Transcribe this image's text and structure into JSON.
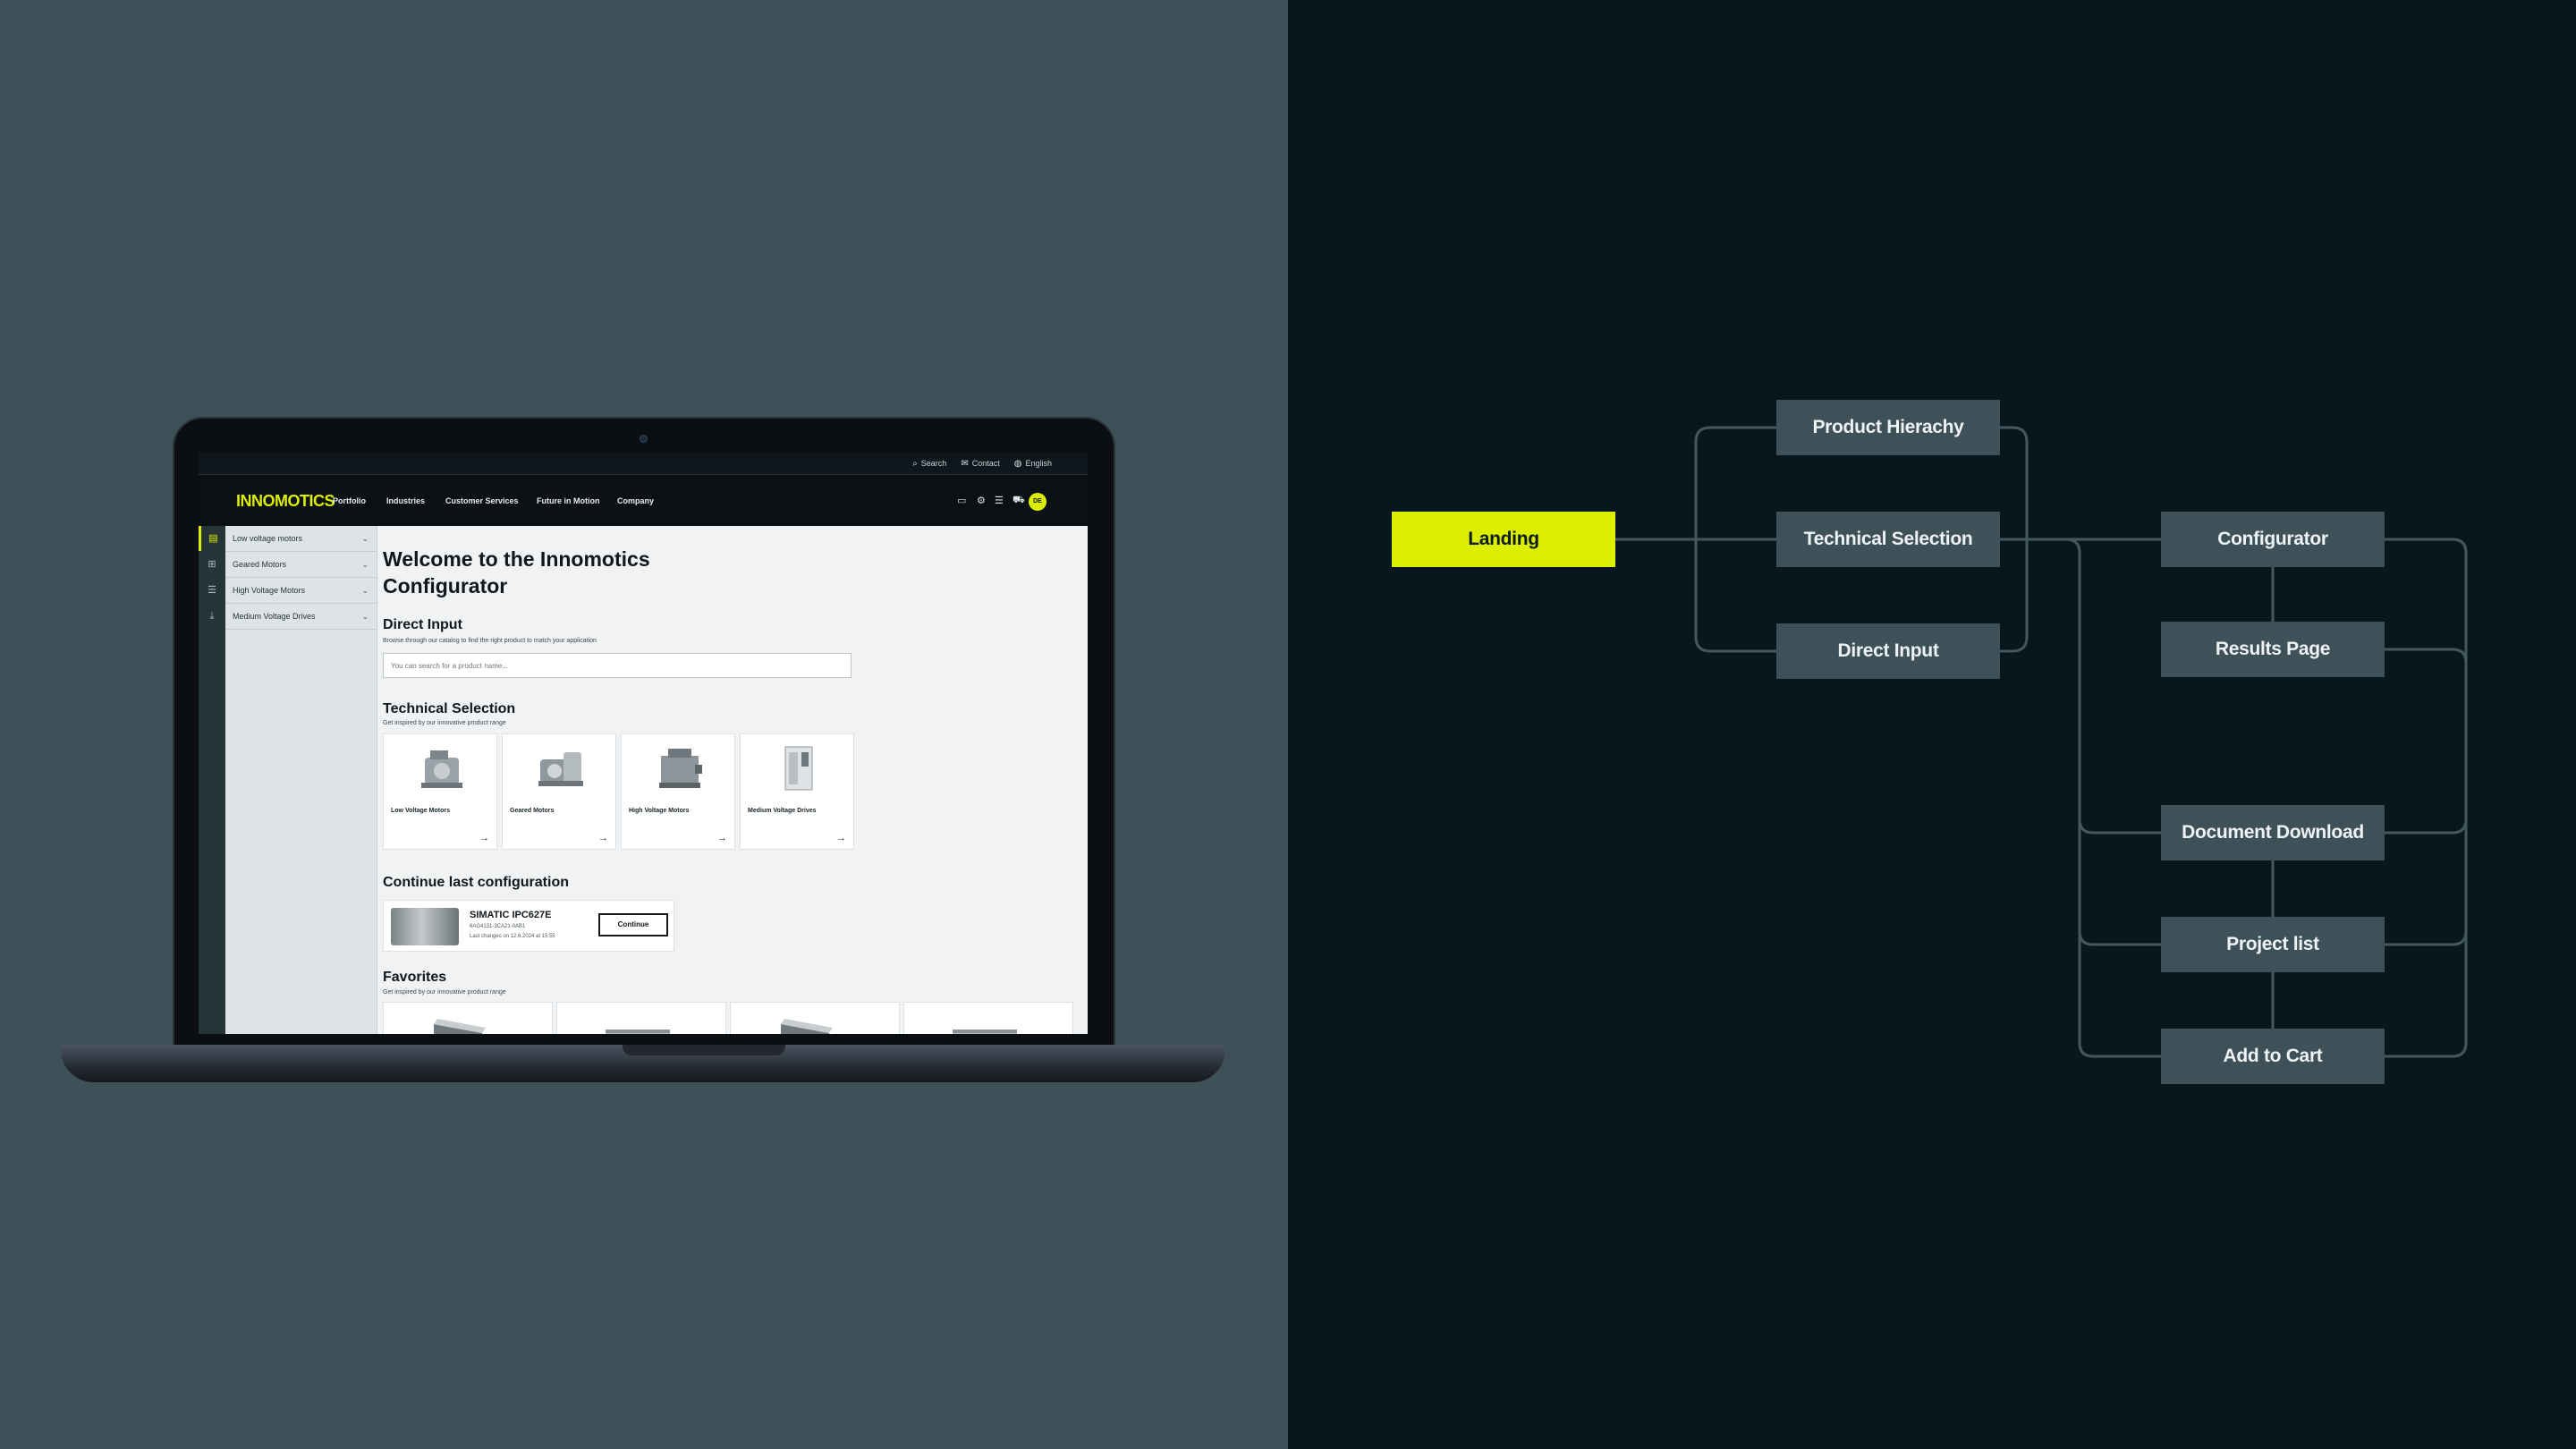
{
  "laptop": {
    "utility_bar": {
      "search": "Search",
      "contact": "Contact",
      "language": "English"
    },
    "nav": {
      "logo": "INNOMOTICS",
      "links": [
        "Portfolio",
        "Industries",
        "Customer Services",
        "Future in Motion",
        "Company"
      ],
      "avatar_initials": "DE"
    },
    "sidebar": {
      "items": [
        "Low voltage motors",
        "Geared Motors",
        "High Voltage Motors",
        "Medium Voltage Drives"
      ]
    },
    "content": {
      "welcome": "Welcome to the Innomotics Configurator",
      "direct_input": {
        "title": "Direct Input",
        "subtitle": "Browse through our catalog to find the right product to match your application",
        "placeholder": "You can search for a product name..."
      },
      "technical_selection": {
        "title": "Technical Selection",
        "subtitle": "Get inspired by our innovative product range",
        "cards": [
          "Low Voltage Motors",
          "Geared Motors",
          "High Voltage Motors",
          "Medium Voltage Drives"
        ]
      },
      "continue": {
        "title": "Continue last configuration",
        "product": "SIMATIC IPC627E",
        "code": "6AG4131-3CA21-0AB1",
        "last_changes": "Last changes on 12.6.2024 at 15:55",
        "button": "Continue"
      },
      "favorites": {
        "title": "Favorites",
        "subtitle": "Get inspired by our innovative product range"
      }
    }
  },
  "diagram": {
    "nodes": {
      "landing": "Landing",
      "product_hierarchy": "Product Hierachy",
      "technical_selection": "Technical Selection",
      "direct_input": "Direct Input",
      "configurator": "Configurator",
      "results_page": "Results Page",
      "document_download": "Document Download",
      "project_list": "Project list",
      "add_to_cart": "Add to Cart"
    },
    "colors": {
      "accent": "#ddef00",
      "node": "#3e5058",
      "line": "#45575e"
    }
  }
}
